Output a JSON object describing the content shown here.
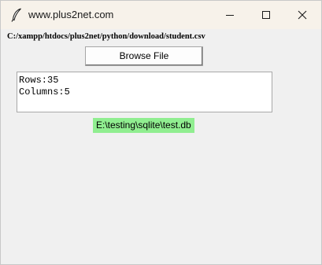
{
  "window": {
    "title": "www.plus2net.com",
    "app_icon": "feather-icon",
    "controls": {
      "minimize_icon": "minimize-icon",
      "maximize_icon": "maximize-icon",
      "close_icon": "close-icon"
    },
    "titlebar_color": "#f7f2ea",
    "background_color": "#f0f0f0"
  },
  "file_path": "C:/xampp/htdocs/plus2net/python/download/student.csv",
  "browse_button": {
    "label": "Browse File"
  },
  "info_text": {
    "value": "Rows:35\nColumns:5"
  },
  "db_label": {
    "text": "E:\\testing\\sqlite\\test.db",
    "background_color": "#90ee90"
  }
}
